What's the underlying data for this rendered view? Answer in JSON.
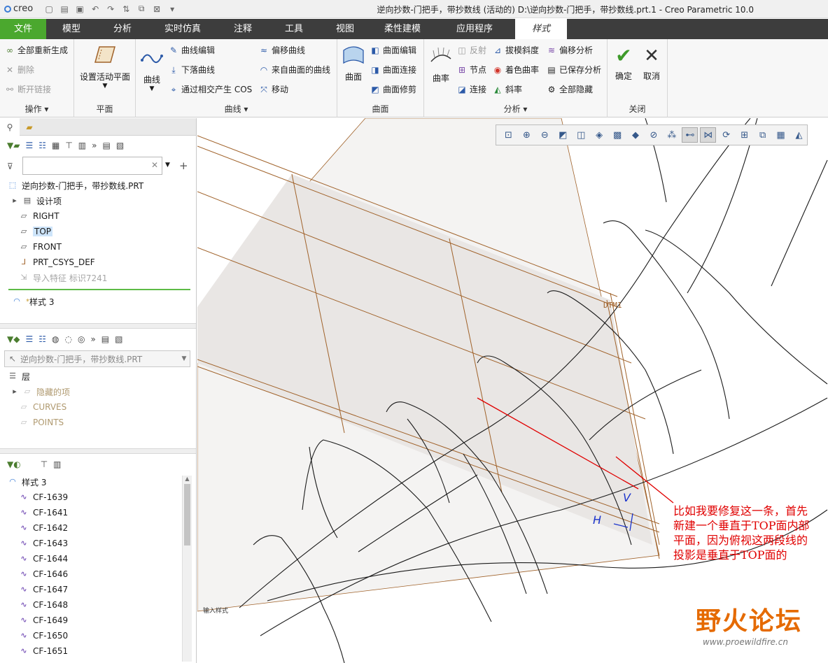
{
  "app": {
    "logo": "creo",
    "window_title": "逆向抄数-门把手，带抄数线 (活动的) D:\\逆向抄数-门把手，带抄数线.prt.1 - Creo Parametric 10.0"
  },
  "tabs": [
    "文件",
    "模型",
    "分析",
    "实时仿真",
    "注释",
    "工具",
    "视图",
    "柔性建模",
    "应用程序",
    "样式"
  ],
  "ribbon": {
    "operations": {
      "label": "操作",
      "items": [
        "全部重新生成",
        "删除",
        "断开链接"
      ]
    },
    "plane": {
      "label": "平面",
      "big_button": "设置活动平面"
    },
    "curve": {
      "label": "曲线",
      "big_button": "曲线",
      "items": [
        "曲线编辑",
        "下落曲线",
        "通过相交产生 COS",
        "偏移曲线",
        "来自曲面的曲线",
        "移动"
      ]
    },
    "surface": {
      "label": "曲面",
      "big_button": "曲面",
      "items": [
        "曲面编辑",
        "曲面连接",
        "曲面修剪"
      ]
    },
    "analysis": {
      "label": "分析",
      "big_button": "曲率",
      "items": [
        "反射",
        "节点",
        "连接",
        "拔模斜度",
        "着色曲率",
        "斜率",
        "偏移分析",
        "已保存分析",
        "全部隐藏"
      ]
    },
    "close": {
      "label": "关闭",
      "ok": "确定",
      "cancel": "取消"
    }
  },
  "model_tree": {
    "root": "逆向抄数-门把手，带抄数线.PRT",
    "items": [
      "设计项",
      "RIGHT",
      "TOP",
      "FRONT",
      "PRT_CSYS_DEF",
      "导入特征 标识7241"
    ],
    "style_feature": "样式 3",
    "new_marker": "*"
  },
  "layer_tree": {
    "selector": "逆向抄数-门把手，带抄数线.PRT",
    "header": "层",
    "items": [
      "隐藏的项",
      "CURVES",
      "POINTS"
    ]
  },
  "style_tree": {
    "root": "样式 3",
    "items": [
      "CF-1639",
      "CF-1641",
      "CF-1642",
      "CF-1643",
      "CF-1644",
      "CF-1646",
      "CF-1647",
      "CF-1648",
      "CF-1649",
      "CF-1650",
      "CF-1651"
    ]
  },
  "viewport": {
    "plane_label": "DTM1",
    "corner_label": "输入样式",
    "annotation": "比如我要修复这一条，首先新建一个垂直于TOP面内部平面，因为俯视这两段线的投影是垂直于TOP面的",
    "axis_labels": [
      "H",
      "V"
    ],
    "watermark": "野火论坛",
    "watermark_url": "www.proewildfire.cn"
  },
  "colors": {
    "file_tab": "#4ba82e",
    "tab_bar": "#3d3d3d",
    "datum_plane": "#a0622a",
    "annotation": "#e00000",
    "watermark": "#e56a00"
  }
}
